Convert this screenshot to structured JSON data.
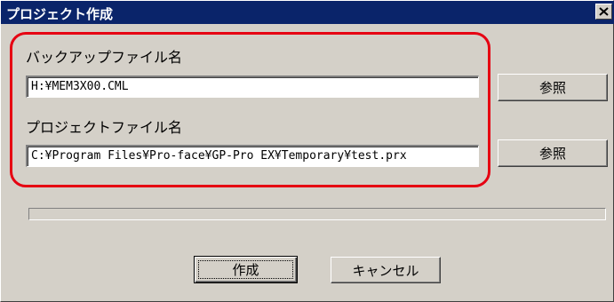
{
  "window": {
    "title": "プロジェクト作成",
    "close_glyph": "✕"
  },
  "backup": {
    "label": "バックアップファイル名",
    "value": "H:¥MEM3X00.CML",
    "browse_label": "参照"
  },
  "project": {
    "label": "プロジェクトファイル名",
    "value": "C:¥Program Files¥Pro-face¥GP-Pro EX¥Temporary¥test.prx",
    "browse_label": "参照"
  },
  "progress": {
    "value": 0
  },
  "footer": {
    "create_label": "作成",
    "cancel_label": "キャンセル"
  },
  "colors": {
    "titlebar": "#0a246a",
    "highlight": "#e60012",
    "dialog_bg": "#d4d0c8"
  }
}
